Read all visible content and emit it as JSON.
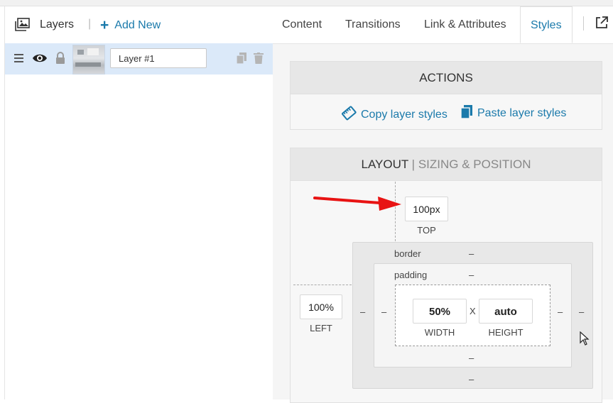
{
  "left_panel": {
    "title": "Layers",
    "add_new": "Add New"
  },
  "layer": {
    "name": "Layer #1"
  },
  "tabs": [
    {
      "label": "Content"
    },
    {
      "label": "Transitions"
    },
    {
      "label": "Link & Attributes"
    },
    {
      "label": "Styles",
      "active": true
    }
  ],
  "actions": {
    "title": "ACTIONS",
    "copy": "Copy layer styles",
    "paste": "Paste layer styles"
  },
  "layout": {
    "title_main": "LAYOUT",
    "title_sep": " | ",
    "title_sub": "SIZING & POSITION",
    "top_value": "100px",
    "top_label": "TOP",
    "left_value": "100%",
    "left_label": "LEFT",
    "border_label": "border",
    "padding_label": "padding",
    "dash": "–",
    "width_value": "50%",
    "width_label": "WIDTH",
    "height_value": "auto",
    "height_label": "HEIGHT",
    "x": "X"
  },
  "colors": {
    "accent": "#1b7aab",
    "selected_row": "#dbe9f9",
    "arrow": "#e81313"
  },
  "icons": [
    "layers-icon",
    "plus-icon",
    "hamburger-icon",
    "eye-icon",
    "lock-icon",
    "duplicate-icon",
    "trash-icon",
    "external-link-icon",
    "copy-styles-icon",
    "paste-styles-icon",
    "arrow-annotation",
    "mouse-cursor-icon"
  ]
}
